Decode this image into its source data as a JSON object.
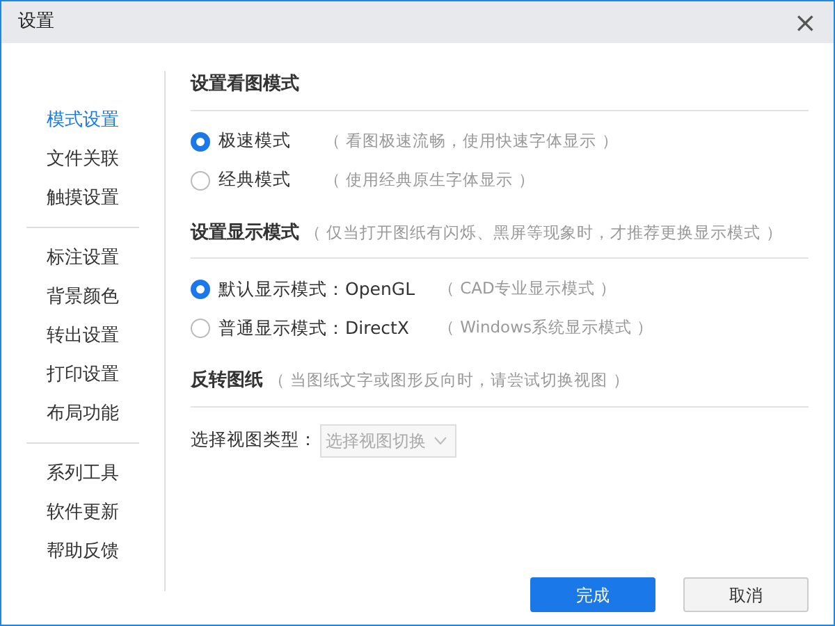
{
  "window": {
    "title": "设置",
    "close": "×"
  },
  "sidebar": {
    "groups": [
      [
        {
          "label": "模式设置",
          "selected": true
        },
        {
          "label": "文件关联",
          "selected": false
        },
        {
          "label": "触摸设置",
          "selected": false
        }
      ],
      [
        {
          "label": "标注设置",
          "selected": false
        },
        {
          "label": "背景颜色",
          "selected": false
        },
        {
          "label": "转出设置",
          "selected": false
        },
        {
          "label": "打印设置",
          "selected": false
        },
        {
          "label": "布局功能",
          "selected": false
        }
      ],
      [
        {
          "label": "系列工具",
          "selected": false
        },
        {
          "label": "软件更新",
          "selected": false
        },
        {
          "label": "帮助反馈",
          "selected": false
        }
      ]
    ]
  },
  "sections": [
    {
      "kind": "radios",
      "title": "设置看图模式",
      "options": [
        {
          "label": "极速模式",
          "hint": "（ 看图极速流畅，使用快速字体显示 ）",
          "selected": true
        },
        {
          "label": "经典模式",
          "hint": "（ 使用经典原生字体显示 ）",
          "selected": false
        }
      ]
    },
    {
      "kind": "radios",
      "title": "设置显示模式",
      "hint": "（ 仅当打开图纸有闪烁、黑屏等现象时，才推荐更换显示模式 ）",
      "options": [
        {
          "label": "默认显示模式：OpenGL",
          "hint": "（ CAD专业显示模式 ）",
          "selected": true
        },
        {
          "label": "普通显示模式：DirectX",
          "hint": "（ Windows系统显示模式 ）",
          "selected": false
        }
      ]
    },
    {
      "kind": "select",
      "title": "反转图纸",
      "hint": "（ 当图纸文字或图形反向时，请尝试切换视图 ）",
      "label": "选择视图类型：",
      "value": "选择视图切换",
      "disabled": true
    }
  ],
  "buttons": [
    {
      "label": "完成",
      "kind": "primary"
    },
    {
      "label": "取消",
      "kind": "secondary"
    }
  ]
}
